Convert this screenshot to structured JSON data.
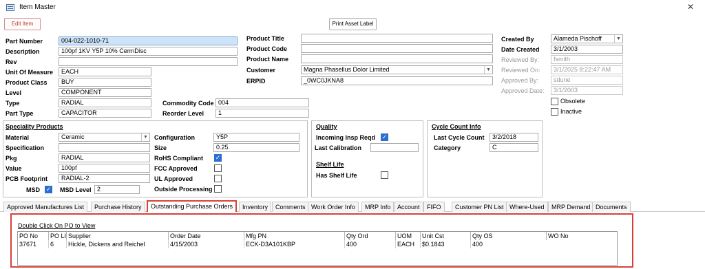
{
  "window": {
    "title": "Item Master",
    "close_glyph": "✕"
  },
  "toolbar": {
    "edit_item": "Edit Item",
    "print_asset_label": "Print Asset Label"
  },
  "main": {
    "part_number": {
      "label": "Part Number",
      "value": "004-022-1010-71"
    },
    "description": {
      "label": "Description",
      "value": "100pf 1KV Y5P 10% CermDisc"
    },
    "rev": {
      "label": "Rev",
      "value": ""
    },
    "unit_of_measure": {
      "label": "Unit Of Measure",
      "value": "EACH"
    },
    "product_class": {
      "label": "Product Class",
      "value": "BUY"
    },
    "level": {
      "label": "Level",
      "value": "COMPONENT"
    },
    "type": {
      "label": "Type",
      "value": "RADIAL"
    },
    "part_type": {
      "label": "Part Type",
      "value": "CAPACITOR"
    },
    "commodity_code": {
      "label": "Commodity Code",
      "value": "004"
    },
    "reorder_level": {
      "label": "Reorder Level",
      "value": "1"
    },
    "product_title": {
      "label": "Product Title",
      "value": ""
    },
    "product_code": {
      "label": "Product Code",
      "value": ""
    },
    "product_name": {
      "label": "Product Name",
      "value": ""
    },
    "customer": {
      "label": "Customer",
      "value": "Magna Phasellus Dolor Limited"
    },
    "erpid": {
      "label": "ERPID",
      "value": "_0WC0JKNA8"
    }
  },
  "right": {
    "created_by": {
      "label": "Created By",
      "value": "Alameda Pischoff"
    },
    "date_created": {
      "label": "Date Created",
      "value": "3/1/2003"
    },
    "reviewed_by": {
      "label": "Reviewed By:",
      "value": "fsmith"
    },
    "reviewed_on": {
      "label": "Reviewed On:",
      "value": "3/1/2025 8:22:47 AM"
    },
    "approved_by": {
      "label": "Approved By:",
      "value": "sdune"
    },
    "approved_date": {
      "label": "Approved Date:",
      "value": "3/1/2003"
    },
    "obsolete": {
      "label": "Obsolete",
      "checked": false
    },
    "inactive": {
      "label": "Inactive",
      "checked": false
    }
  },
  "speciality": {
    "title": "Speciality Products",
    "material": {
      "label": "Material",
      "value": "Ceramic"
    },
    "specification": {
      "label": "Specification",
      "value": ""
    },
    "pkg": {
      "label": "Pkg",
      "value": "RADIAL"
    },
    "value": {
      "label": "Value",
      "value": "100pf"
    },
    "pcb_footprint": {
      "label": "PCB Footprint",
      "value": "RADIAL-2"
    },
    "msd": {
      "label": "MSD",
      "checked": true
    },
    "msd_level": {
      "label": "MSD Level",
      "value": "2"
    },
    "configuration": {
      "label": "Configuration",
      "value": "Y5P"
    },
    "size": {
      "label": "Size",
      "value": "0.25"
    },
    "rohs_compliant": {
      "label": "RoHS Compliant",
      "checked": true
    },
    "fcc_approved": {
      "label": "FCC Approved",
      "checked": false
    },
    "ul_approved": {
      "label": "UL Approved",
      "checked": false
    },
    "outside_processing": {
      "label": "Outside Processing",
      "checked": false
    }
  },
  "quality": {
    "title": "Quality",
    "incoming_insp_reqd": {
      "label": "Incoming Insp Reqd",
      "checked": true
    },
    "last_calibration": {
      "label": "Last Calibration",
      "value": ""
    },
    "shelf_life_title": "Shelf Life",
    "has_shelf_life": {
      "label": "Has Shelf Life",
      "checked": false
    }
  },
  "cycle_count": {
    "title": "Cycle Count Info",
    "last_cycle_count": {
      "label": "Last Cycle Count",
      "value": "3/2/2018"
    },
    "category": {
      "label": "Category",
      "value": "C"
    }
  },
  "tabs": [
    {
      "label": "Approved Manufactures List"
    },
    {
      "label": "Purchase History"
    },
    {
      "label": "Outstanding Purchase Orders"
    },
    {
      "label": "Inventory"
    },
    {
      "label": "Comments"
    },
    {
      "label": "Work Order Info"
    },
    {
      "label": "MRP Info"
    },
    {
      "label": "Account"
    },
    {
      "label": "FIFO"
    },
    {
      "label": "Customer PN List"
    },
    {
      "label": "Where-Used"
    },
    {
      "label": "MRP Demand"
    },
    {
      "label": "Documents"
    }
  ],
  "active_tab_index": 2,
  "po_panel": {
    "hint": "Double Click On PO to View",
    "columns": [
      "PO No",
      "PO LI",
      "Supplier",
      "Order Date",
      "Mfg PN",
      "Qty Ord",
      "UOM",
      "Unit Cst",
      "Qty OS",
      "WO No"
    ],
    "rows": [
      [
        "37671",
        "6",
        "Hickle, Dickens and Reichel",
        "4/15/2003",
        "ECK-D3A101KBP",
        "400",
        "EACH",
        "$0.1843",
        "400",
        ""
      ]
    ]
  },
  "colors": {
    "highlight_red": "#d9403b",
    "checkbox_blue": "#2a6fd1",
    "selection": "#cde3f7"
  },
  "icons": {
    "app": "form-icon",
    "close": "close-icon",
    "dropdown": "chevron-down-icon",
    "check": "checkmark-icon"
  }
}
